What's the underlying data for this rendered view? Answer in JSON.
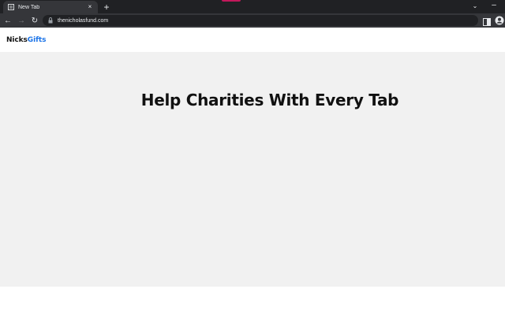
{
  "browser": {
    "tab": {
      "title": "New Tab",
      "favicon": "document-icon",
      "close": "×"
    },
    "new_tab_label": "+",
    "tab_search_label": "⌄",
    "minimize_label": "–",
    "address_bar": {
      "url": "thenicholasfund.com",
      "security_icon": "lock-icon"
    },
    "nav": {
      "back": "←",
      "forward": "→",
      "reload": "↻"
    }
  },
  "site": {
    "logo": {
      "part1": "Nicks",
      "part2": "Gifts",
      "accent_color": "#1a73e8"
    },
    "hero": {
      "title": "Help Charities With Every Tab",
      "background": "#f1f1f1"
    }
  }
}
